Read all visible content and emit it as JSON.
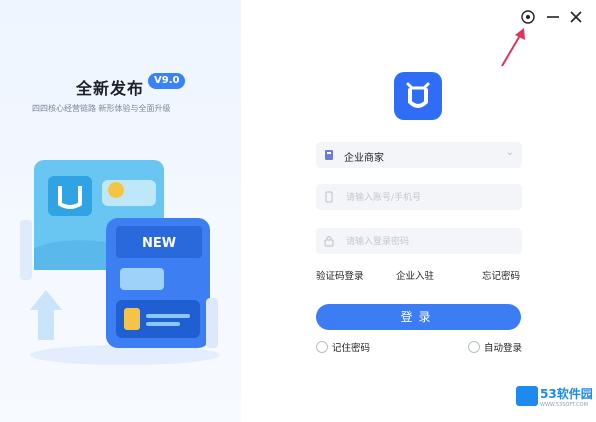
{
  "promo": {
    "title": "全新发布",
    "version": "V9.0",
    "subtitle": "四四核心经营链路 新形体验与全面升级",
    "card_tag": "NEW"
  },
  "window_controls": {
    "settings_icon": "gear-icon",
    "minimize_icon": "minimize-icon",
    "close_icon": "close-icon"
  },
  "login": {
    "company_value": "企业商家",
    "account_placeholder": "请输入账号/手机号",
    "password_placeholder": "请输入登录密码",
    "links": {
      "sms_login": "验证码登录",
      "enterprise_join": "企业入驻",
      "forgot_password": "忘记密码"
    },
    "submit_label": "登录",
    "remember_password": "记住密码",
    "auto_login": "自动登录"
  },
  "watermark": {
    "brand": "53软件园",
    "url": "WWW.53SOFT.COM"
  },
  "colors": {
    "accent": "#3c7df4",
    "badge": "#3b82f6",
    "arrow": "#e0345a"
  }
}
